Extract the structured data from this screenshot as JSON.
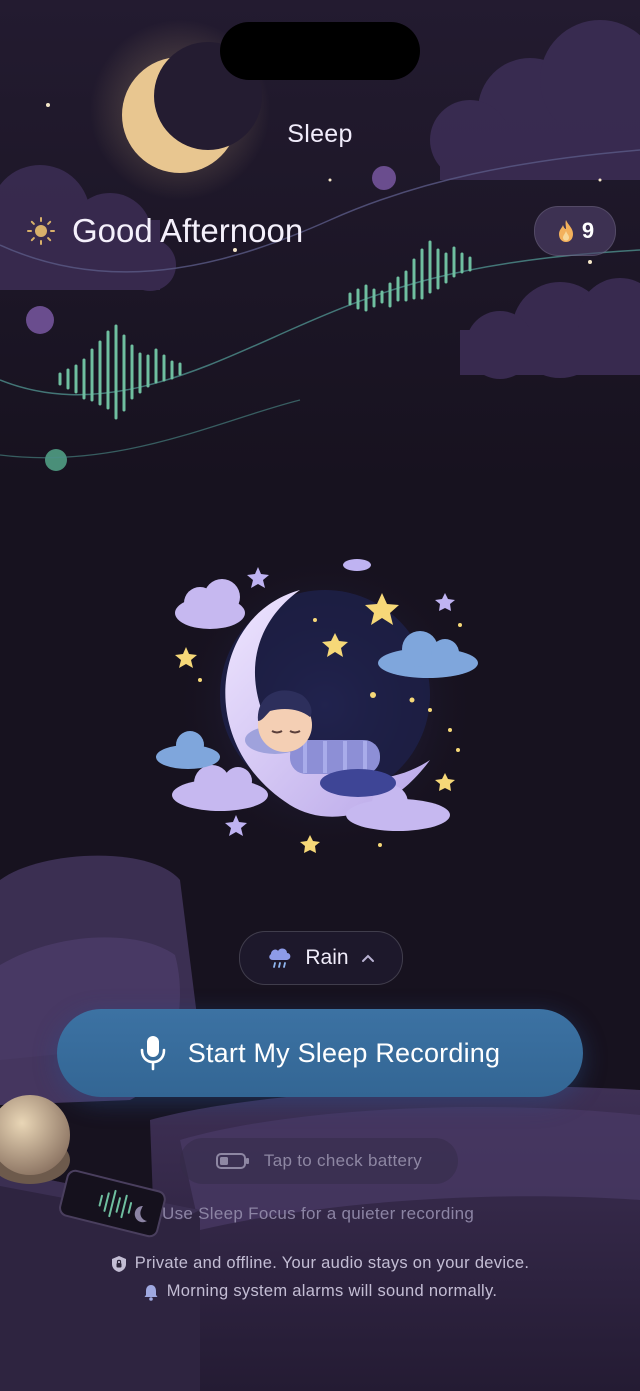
{
  "header": {
    "title": "Sleep",
    "greeting": "Good Afternoon",
    "streak_count": "9"
  },
  "sound": {
    "selected": "Rain"
  },
  "actions": {
    "start_label": "Start My Sleep Recording",
    "battery_label": "Tap to check battery",
    "focus_hint": "Use Sleep Focus for a quieter recording"
  },
  "notes": {
    "privacy": "Private and offline. Your audio stays on your device.",
    "alarms": "Morning system alarms will sound normally."
  },
  "colors": {
    "background": "#17121f",
    "accent_button": "#3a6fa0",
    "wave_green": "#6fbfa0",
    "moon": "#e8c690",
    "streak_flame": "#f3b15c"
  },
  "icons": [
    "moon-icon",
    "sun-icon",
    "flame-icon",
    "rain-cloud-icon",
    "chevron-up-icon",
    "microphone-icon",
    "battery-icon",
    "sleep-focus-icon",
    "shield-lock-icon",
    "bell-icon"
  ]
}
